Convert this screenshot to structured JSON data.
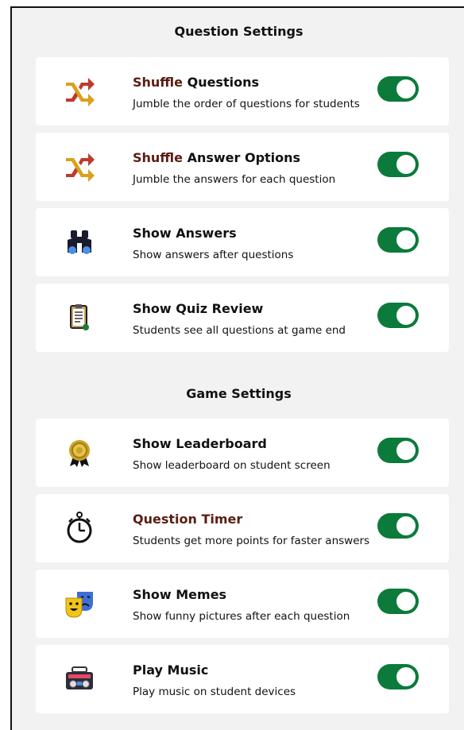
{
  "question_settings": {
    "title": "Question Settings",
    "items": [
      {
        "title_hl": "Shuffle",
        "title_rest": " Questions",
        "desc": "Jumble the order of questions for students",
        "icon": "shuffle-icon",
        "on": true
      },
      {
        "title_hl": "Shuffle",
        "title_rest": " Answer Options",
        "desc": "Jumble the answers for each question",
        "icon": "shuffle-icon",
        "on": true
      },
      {
        "title_hl": "",
        "title_rest": "Show Answers",
        "desc": "Show answers after questions",
        "icon": "binoculars-icon",
        "on": true
      },
      {
        "title_hl": "",
        "title_rest": "Show Quiz Review",
        "desc": "Students see all questions at game end",
        "icon": "clipboard-icon",
        "on": true
      }
    ]
  },
  "game_settings": {
    "title": "Game Settings",
    "items": [
      {
        "title_hl": "",
        "title_rest": "Show Leaderboard",
        "desc": "Show leaderboard on student screen",
        "icon": "medal-icon",
        "on": true
      },
      {
        "title_hl": "Question Timer",
        "title_rest": "",
        "desc": "Students get more points for faster answers",
        "icon": "stopwatch-icon",
        "on": true
      },
      {
        "title_hl": "",
        "title_rest": "Show Memes",
        "desc": "Show funny pictures after each question",
        "icon": "theater-masks-icon",
        "on": true
      },
      {
        "title_hl": "",
        "title_rest": "Play Music",
        "desc": "Play music on student devices",
        "icon": "boombox-icon",
        "on": true
      }
    ]
  },
  "colors": {
    "toggle_on": "#0b7a3b",
    "highlight_title": "#5a1d12",
    "panel_bg": "#f2f2f2"
  }
}
